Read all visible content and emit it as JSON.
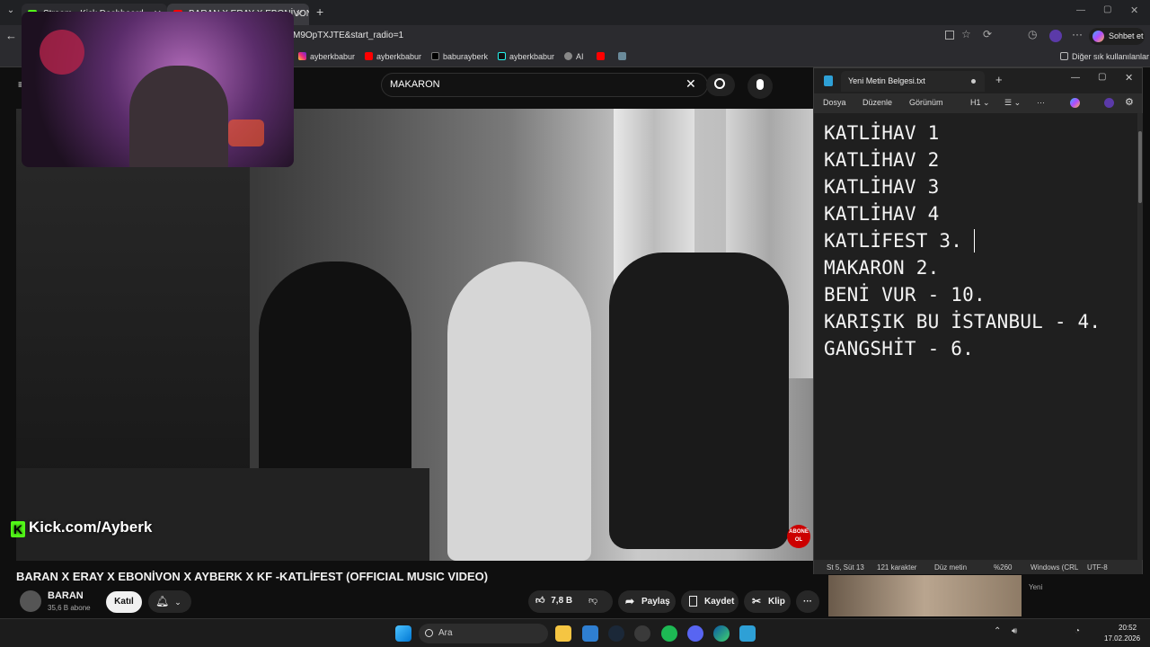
{
  "browser": {
    "tabs": [
      {
        "label": "Stream - Kick Dashboard",
        "color": "#53fc18"
      },
      {
        "label": "BARAN X ERAY X EBONİVON",
        "color": "#ff0000"
      }
    ],
    "url": "M9OpTXJTE&start_radio=1",
    "profile_label": "Sohbet et",
    "bookmarks": [
      {
        "label": "ayberkbabur",
        "icon": "instagram-icon"
      },
      {
        "label": "ayberkbabur",
        "icon": "youtube-icon"
      },
      {
        "label": "baburayberk",
        "icon": "x-icon"
      },
      {
        "label": "ayberkbabur",
        "icon": "tiktok-icon"
      },
      {
        "label": "AI",
        "icon": "ai-icon"
      }
    ],
    "other_bookmarks": "Diğer sık kullanılanlar"
  },
  "youtube": {
    "search_value": "MAKARON",
    "video_title": "BARAN X ERAY X EBONİVON X AYBERK X KF -KATLİFEST (OFFICIAL MUSIC VIDEO)",
    "channel_name": "BARAN",
    "subscribers": "35,6 B abone",
    "join_label": "Katıl",
    "likes": "7,8 B",
    "share_label": "Paylaş",
    "save_label": "Kaydet",
    "clip_label": "Klip",
    "subscribe_badge": "ABONE OL",
    "sidebar_new": "Yeni"
  },
  "overlay": {
    "kick_text": "Kick.com/Ayberk"
  },
  "notepad": {
    "title": "Yeni Metin Belgesi.txt",
    "menu": [
      "Dosya",
      "Düzenle",
      "Görünüm"
    ],
    "heading_button": "H1",
    "lines": [
      "KATLİHAV 1",
      "KATLİHAV 2",
      "KATLİHAV 3",
      "KATLİHAV 4",
      "KATLİFEST 3.",
      "MAKARON 2.",
      "BENİ VUR - 10.",
      "KARIŞIK BU İSTANBUL - 4.",
      "GANGSHİT - 6."
    ],
    "status": {
      "position": "St 5, Süt 13",
      "chars": "121 karakter",
      "format": "Düz metin",
      "zoom": "%260",
      "line_ending": "Windows (CRL",
      "encoding": "UTF-8"
    }
  },
  "taskbar": {
    "search_placeholder": "Ara",
    "time": "20:52",
    "date": "17.02.2026"
  }
}
